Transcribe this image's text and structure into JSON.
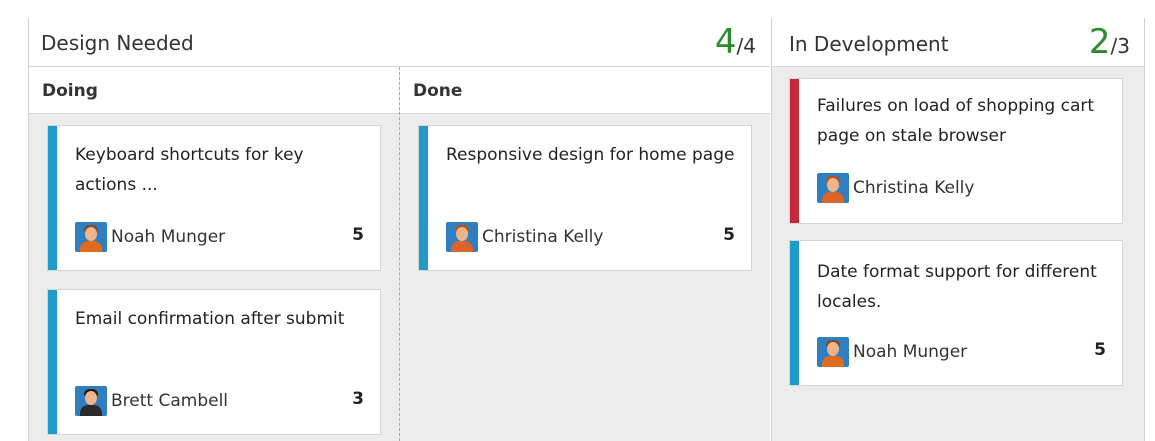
{
  "colors": {
    "stripe_blue": "#1f9ac9",
    "stripe_red": "#c4283a",
    "wip_green": "#2c8c2c",
    "avatar_bg": "#2d7fc2"
  },
  "columns": [
    {
      "title": "Design Needed",
      "wip_current": "4",
      "wip_limit": "/4",
      "lanes": [
        {
          "title": "Doing",
          "cards": [
            {
              "title": "Keyboard shortcuts for key actions ...",
              "assignee": "Noah Munger",
              "points": "5",
              "stripe": "blue",
              "avatar_icon": "avatar-icon"
            },
            {
              "title": "Email confirmation after submit",
              "assignee": "Brett Cambell",
              "points": "3",
              "stripe": "blue",
              "avatar_icon": "avatar-icon"
            }
          ]
        },
        {
          "title": "Done",
          "cards": [
            {
              "title": "Responsive design for home page",
              "assignee": "Christina Kelly",
              "points": "5",
              "stripe": "blue",
              "avatar_icon": "avatar-icon"
            }
          ]
        }
      ]
    },
    {
      "title": "In Development",
      "wip_current": "2",
      "wip_limit": "/3",
      "cards": [
        {
          "title": "Failures on load of shopping cart page on stale browser",
          "assignee": "Christina Kelly",
          "points": "",
          "stripe": "red",
          "avatar_icon": "avatar-icon"
        },
        {
          "title": "Date format support for different locales.",
          "assignee": "Noah Munger",
          "points": "5",
          "stripe": "blue",
          "avatar_icon": "avatar-icon"
        }
      ]
    }
  ]
}
